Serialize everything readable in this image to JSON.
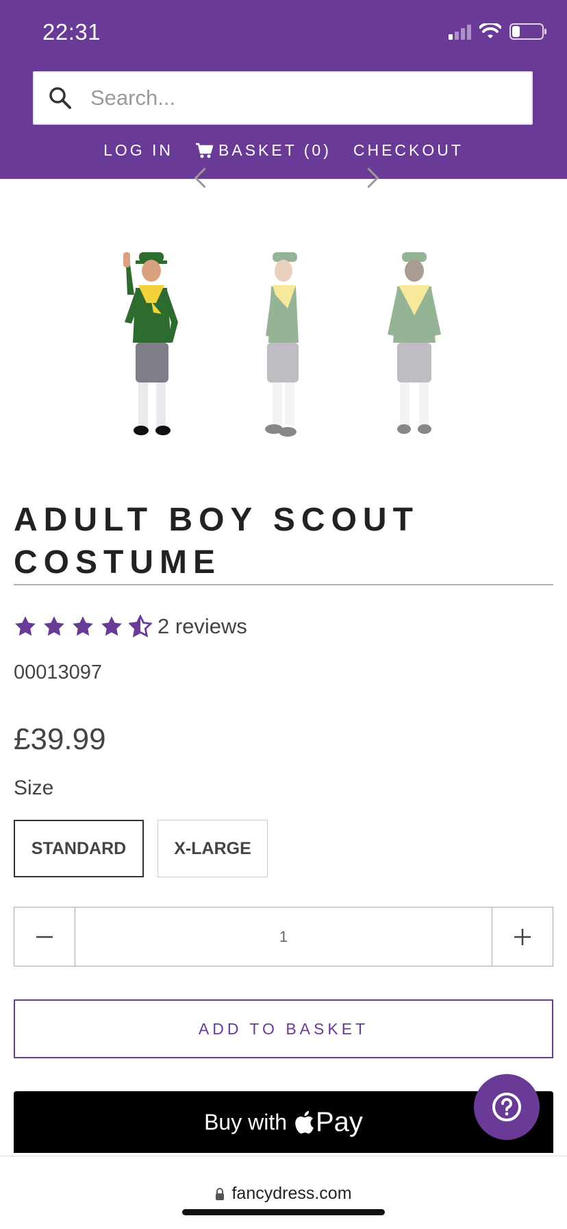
{
  "status": {
    "time": "22:31"
  },
  "search": {
    "placeholder": "Search..."
  },
  "nav": {
    "login": "LOG IN",
    "basket": "BASKET (0)",
    "checkout": "CHECKOUT"
  },
  "product": {
    "title_line1": "ADULT BOY SCOUT",
    "title_line2": "COSTUME",
    "rating": 4.5,
    "reviews": "2 reviews",
    "sku": "00013097",
    "price": "£39.99",
    "size_label": "Size",
    "sizes": [
      "STANDARD",
      "X-LARGE"
    ],
    "selected_size": "STANDARD",
    "quantity": "1",
    "add_to_basket": "ADD TO BASKET",
    "buy_with": "Buy with",
    "pay_word": "Pay"
  },
  "browser": {
    "url": "fancydress.com"
  },
  "colors": {
    "brand_purple": "#6a3a97",
    "costume_green": "#2e6b2e",
    "scarf_yellow": "#f2d33b"
  },
  "icons": [
    "search-icon",
    "cart-icon",
    "star-icon",
    "minus-icon",
    "plus-icon",
    "apple-icon",
    "help-icon",
    "lock-icon",
    "wifi-icon",
    "battery-icon",
    "signal-icon"
  ]
}
